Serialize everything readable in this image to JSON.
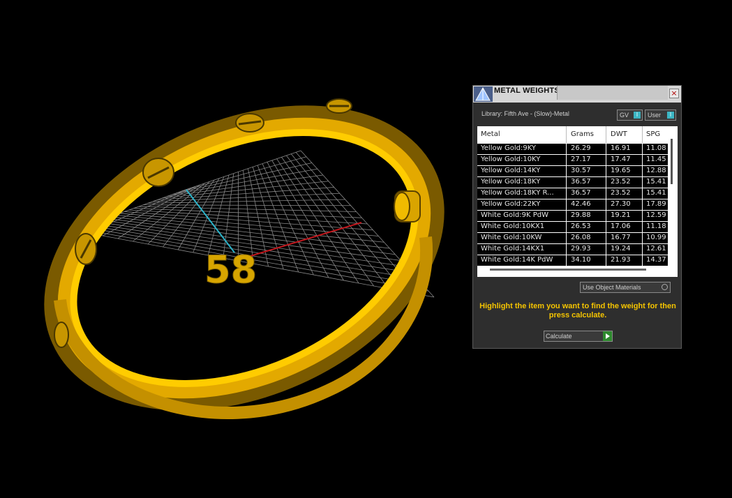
{
  "viewport": {
    "size_label": "58",
    "colors": {
      "bangle": "#f2b400",
      "grid": "#8a8a8a",
      "axis_x": "#c0161c",
      "axis_y": "#2bb3c9"
    }
  },
  "panel": {
    "title": "METAL WEIGHTS",
    "close_label": "×",
    "library_label": "Library: Fifth Ave - (Slow)-Metal",
    "toggles": {
      "gv": "GV",
      "user": "User",
      "toggle_indicator": "I"
    },
    "table": {
      "headers": [
        "Metal",
        "Grams",
        "DWT",
        "SPG"
      ],
      "rows": [
        [
          "Yellow Gold:9KY",
          "26.29",
          "16.91",
          "11.08"
        ],
        [
          "Yellow Gold:10KY",
          "27.17",
          "17.47",
          "11.45"
        ],
        [
          "Yellow Gold:14KY",
          "30.57",
          "19.65",
          "12.88"
        ],
        [
          "Yellow Gold:18KY",
          "36.57",
          "23.52",
          "15.41"
        ],
        [
          "Yellow Gold:18KY R...",
          "36.57",
          "23.52",
          "15.41"
        ],
        [
          "Yellow Gold:22KY",
          "42.46",
          "27.30",
          "17.89"
        ],
        [
          "White Gold:9K PdW",
          "29.88",
          "19.21",
          "12.59"
        ],
        [
          "White Gold:10KX1",
          "26.53",
          "17.06",
          "11.18"
        ],
        [
          "White Gold:10KW",
          "26.08",
          "16.77",
          "10.99"
        ],
        [
          "White Gold:14KX1",
          "29.93",
          "19.24",
          "12.61"
        ],
        [
          "White Gold:14K PdW",
          "34.10",
          "21.93",
          "14.37"
        ]
      ]
    },
    "use_object_materials": "Use Object Materials",
    "instructions": "Highlight the item you want to find the weight for then press calculate.",
    "calculate_label": "Calculate"
  }
}
